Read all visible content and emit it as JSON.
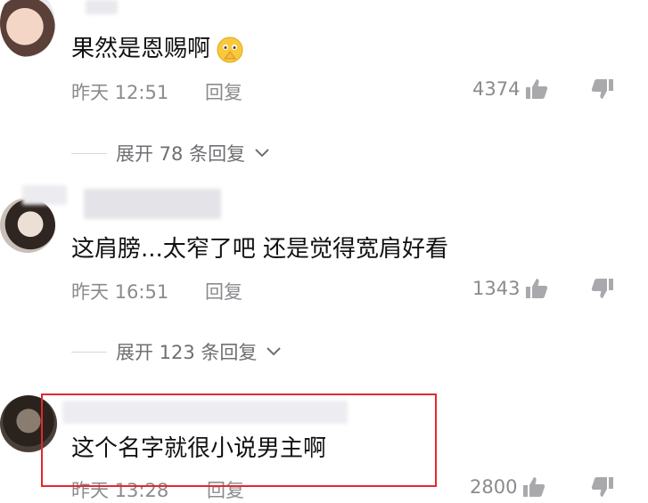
{
  "comments": [
    {
      "text": "果然是恩赐啊",
      "time": "昨天 12:51",
      "reply_label": "回复",
      "likes": "4374",
      "expand_text": "展开 78 条回复"
    },
    {
      "text": "这肩膀...太窄了吧 还是觉得宽肩好看",
      "time": "昨天 16:51",
      "reply_label": "回复",
      "likes": "1343",
      "expand_text": "展开 123 条回复"
    },
    {
      "text": "这个名字就很小说男主啊",
      "time": "昨天 13:28",
      "reply_label": "回复",
      "likes": "2800"
    }
  ],
  "icons": {
    "like": "thumb-up-icon",
    "dislike": "thumb-down-icon",
    "expand": "chevron-down-icon",
    "emoji": "praying-face-emoji-icon"
  },
  "colors": {
    "highlight": "#e3292e",
    "meta_text": "#8b8b8f",
    "body_text": "#111111"
  }
}
